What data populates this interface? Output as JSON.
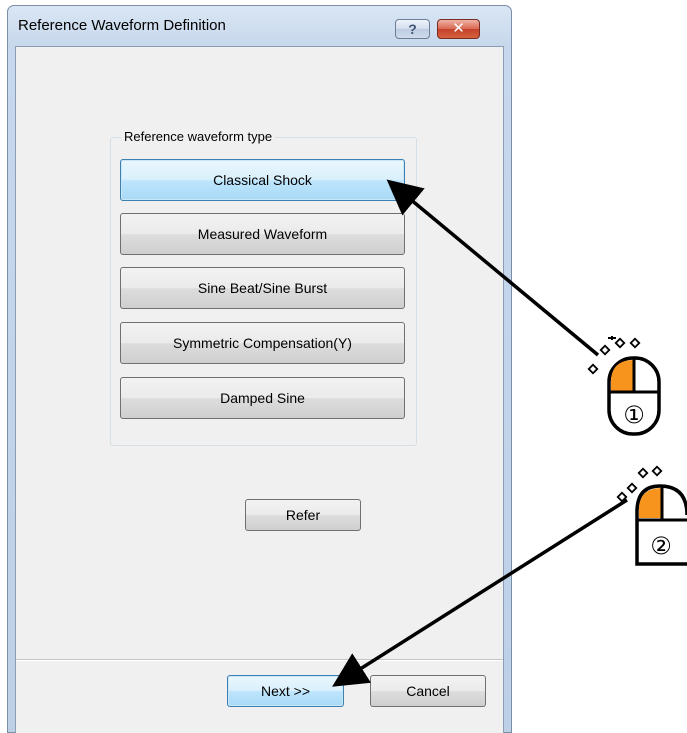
{
  "window": {
    "title": "Reference Waveform Definition",
    "help_label": "?",
    "close_label": "✕"
  },
  "group": {
    "label": "Reference waveform type",
    "buttons": [
      {
        "label": "Classical Shock",
        "selected": true
      },
      {
        "label": "Measured Waveform",
        "selected": false
      },
      {
        "label": "Sine Beat/Sine Burst",
        "selected": false
      },
      {
        "label": "Symmetric Compensation(Y)",
        "selected": false
      },
      {
        "label": "Damped Sine",
        "selected": false
      }
    ]
  },
  "refer_button": "Refer",
  "footer": {
    "next_label": "Next >>",
    "cancel_label": "Cancel"
  },
  "annotations": {
    "step1_label": "①",
    "step2_label": "②",
    "mouse_icon": "mouse-left-click-icon",
    "arrow_color": "#000000",
    "mouse_highlight_color": "#f7941d"
  },
  "colors": {
    "selected_button": "#bee6fd",
    "close_button": "#c4412a"
  }
}
